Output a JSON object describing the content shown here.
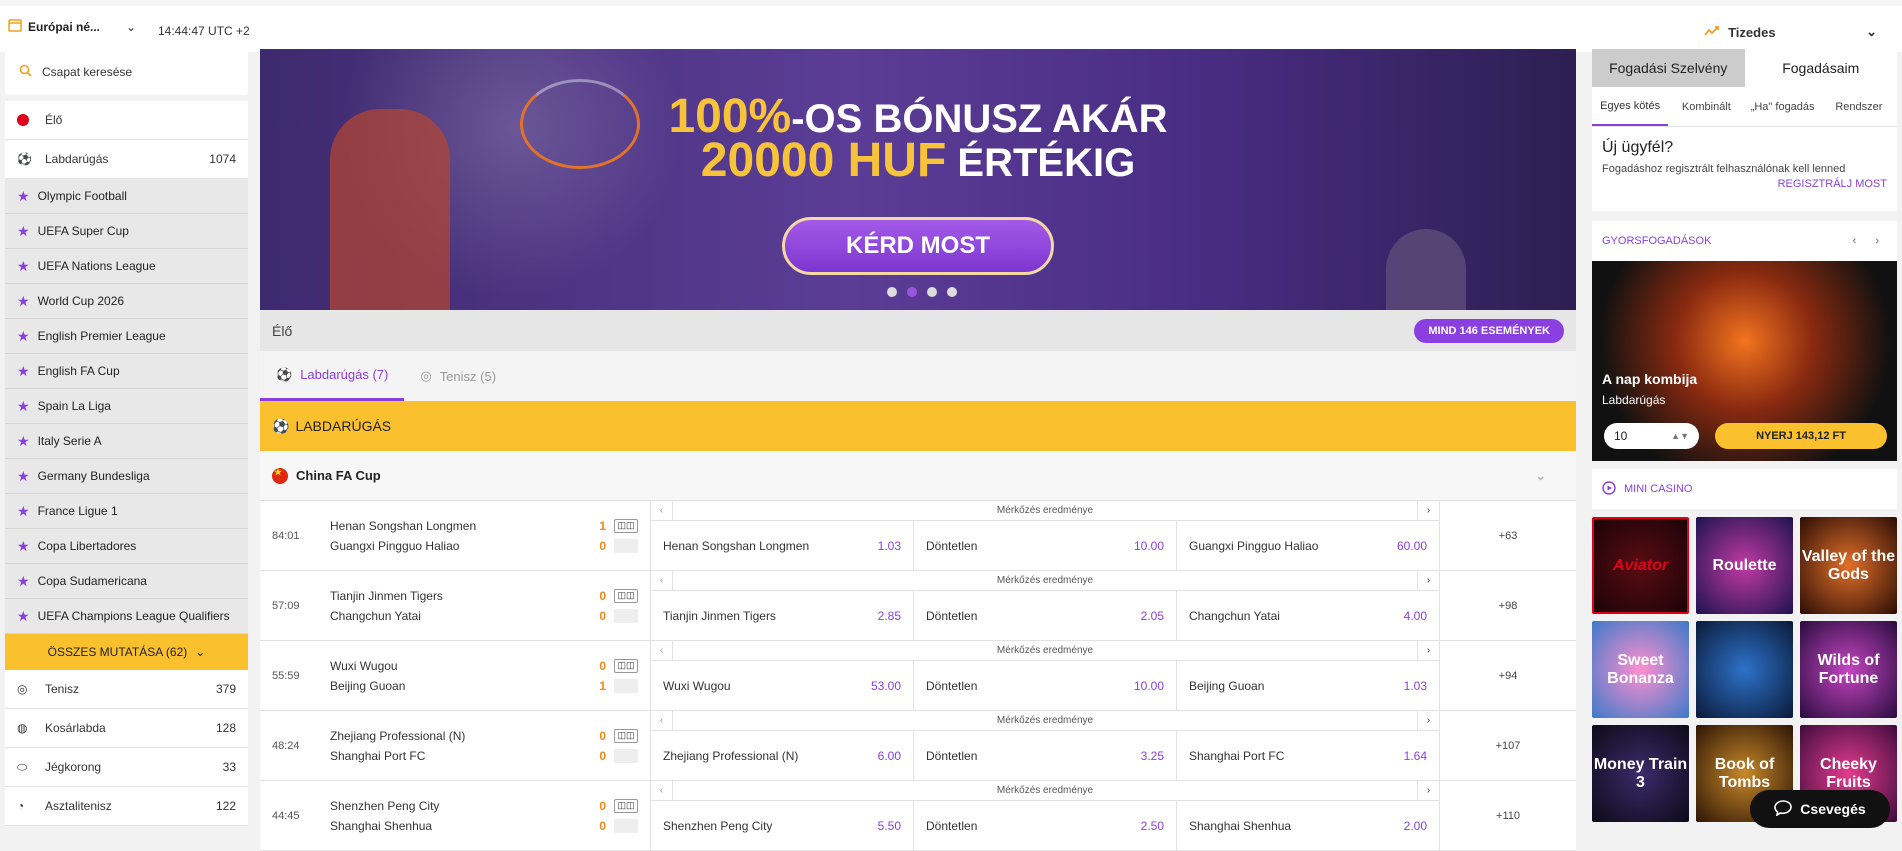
{
  "topbar": {
    "odds_format_select": "Európai né...",
    "time": "14:44:47 UTC +2",
    "odds_type": "Tizedes"
  },
  "sidebar": {
    "search_placeholder": "Csapat keresése",
    "live_label": "Élő",
    "football": {
      "label": "Labdarúgás",
      "count": "1074"
    },
    "leagues": [
      "Olympic Football",
      "UEFA Super Cup",
      "UEFA Nations League",
      "World Cup 2026",
      "English Premier League",
      "English FA Cup",
      "Spain La Liga",
      "Italy Serie A",
      "Germany Bundesliga",
      "France Ligue 1",
      "Copa Libertadores",
      "Copa Sudamericana",
      "UEFA Champions League Qualifiers"
    ],
    "show_all": "ÖSSZES MUTATÁSA (62)",
    "sports": [
      {
        "label": "Tenisz",
        "count": "379"
      },
      {
        "label": "Kosárlabda",
        "count": "128"
      },
      {
        "label": "Jégkorong",
        "count": "33"
      },
      {
        "label": "Asztalitenisz",
        "count": "122"
      }
    ]
  },
  "banner": {
    "line1_highlight": "100%",
    "line1_rest": "-OS BÓNUSZ AKÁR",
    "line2_highlight": "20000 HUF",
    "line2_rest": "ÉRTÉKIG",
    "cta": "KÉRD MOST",
    "active_slide": 2,
    "slide_count": 4
  },
  "live": {
    "title": "Élő",
    "all_events": "MIND 146 ESEMÉNYEK",
    "tabs": [
      {
        "label": "Labdarúgás (7)",
        "active": true
      },
      {
        "label": "Tenisz (5)",
        "active": false
      }
    ],
    "sport_header": "LABDARÚGÁS",
    "league": "China FA Cup",
    "market_label": "Mérkőzés eredménye",
    "draw_label": "Döntetlen",
    "matches": [
      {
        "time": "84:01",
        "home": "Henan Songshan Longmen",
        "away": "Guangxi Pingguo Haliao",
        "home_score": "1",
        "away_score": "0",
        "odd_home": "1.03",
        "odd_draw": "10.00",
        "odd_away": "60.00",
        "more": "+63"
      },
      {
        "time": "57:09",
        "home": "Tianjin Jinmen Tigers",
        "away": "Changchun Yatai",
        "home_score": "0",
        "away_score": "0",
        "odd_home": "2.85",
        "odd_draw": "2.05",
        "odd_away": "4.00",
        "more": "+98"
      },
      {
        "time": "55:59",
        "home": "Wuxi Wugou",
        "away": "Beijing Guoan",
        "home_score": "0",
        "away_score": "1",
        "odd_home": "53.00",
        "odd_draw": "10.00",
        "odd_away": "1.03",
        "more": "+94"
      },
      {
        "time": "48:24",
        "home": "Zhejiang Professional (N)",
        "away": "Shanghai Port FC",
        "home_score": "0",
        "away_score": "0",
        "odd_home": "6.00",
        "odd_draw": "3.25",
        "odd_away": "1.64",
        "more": "+107"
      },
      {
        "time": "44:45",
        "home": "Shenzhen Peng City",
        "away": "Shanghai Shenhua",
        "home_score": "0",
        "away_score": "0",
        "odd_home": "5.50",
        "odd_draw": "2.50",
        "odd_away": "2.00",
        "more": "+110"
      }
    ]
  },
  "betslip": {
    "tabs": [
      "Fogadási Szelvény",
      "Fogadásaim"
    ],
    "bet_types": [
      "Egyes kötés",
      "Kombinált",
      "„Ha\" fogadás",
      "Rendszer"
    ],
    "new_client_title": "Új ügyfél?",
    "new_client_text": "Fogadáshoz regisztrált felhasználónak kell lenned",
    "register_link": "REGISZTRÁLJ MOST"
  },
  "quick_bets": {
    "title": "GYORSFOGADÁSOK",
    "card_title": "A nap kombija",
    "card_sub": "Labdarúgás",
    "stake": "10",
    "win_button": "NYERJ 143,12 FT"
  },
  "mini_casino": {
    "title": "MINI CASINO",
    "games": [
      "Aviator",
      "Roulette",
      "Valley of the Gods",
      "Sweet Bonanza",
      "",
      "Wilds of Fortune",
      "Money Train 3",
      "Book of Tombs",
      "Cheeky Fruits"
    ]
  },
  "chat": {
    "label": "Csevegés"
  }
}
